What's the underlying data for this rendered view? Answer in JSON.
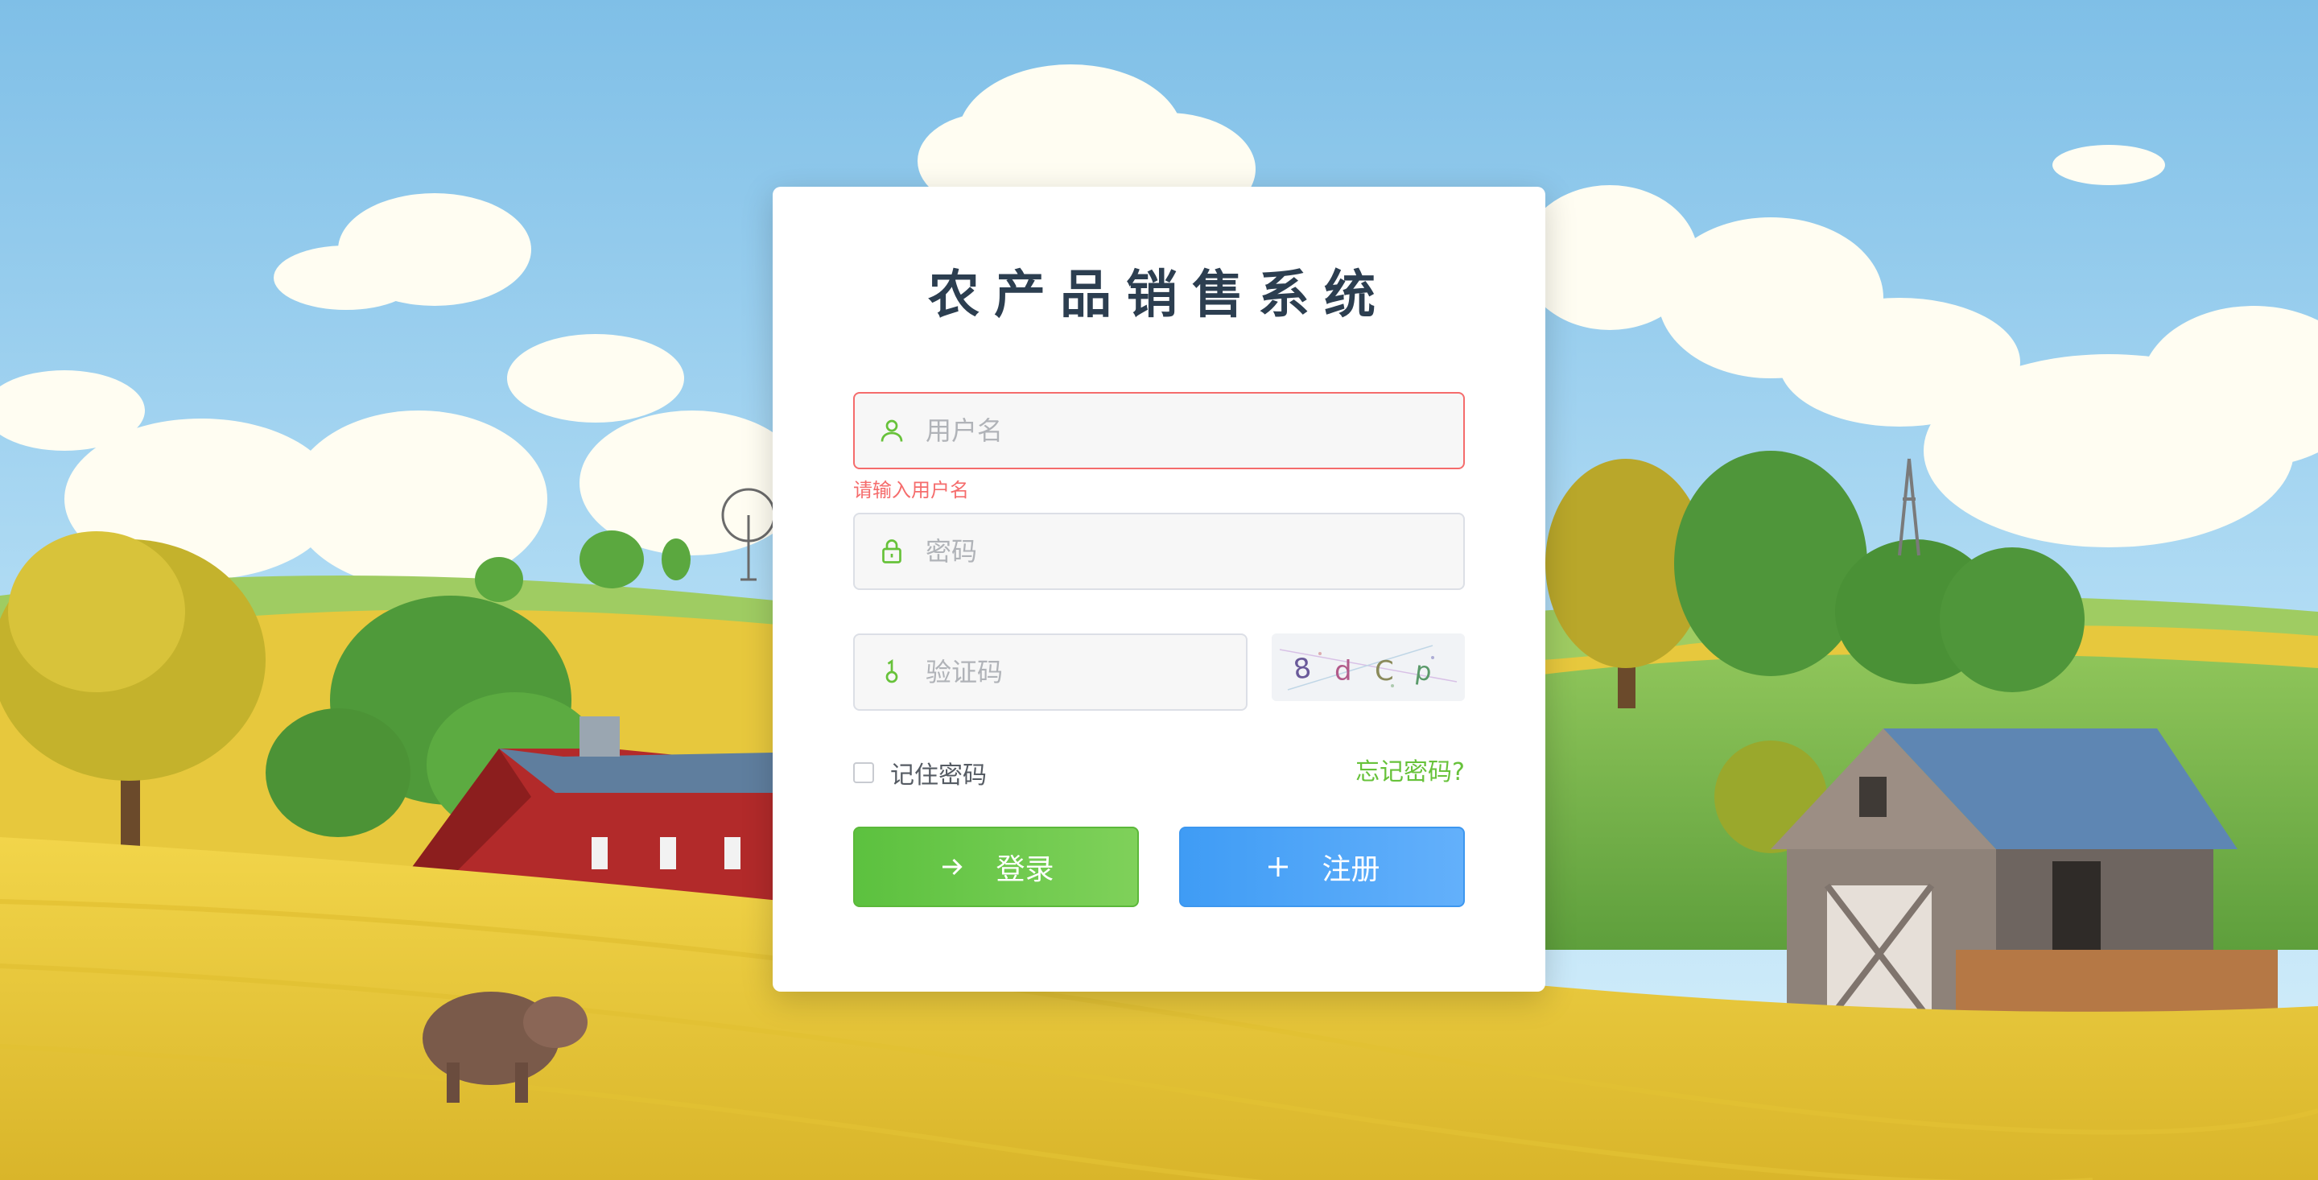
{
  "app": {
    "title": "农产品销售系统"
  },
  "form": {
    "username": {
      "placeholder": "用户名",
      "value": "",
      "error": "请输入用户名",
      "icon": "user-icon"
    },
    "password": {
      "placeholder": "密码",
      "value": "",
      "icon": "lock-icon"
    },
    "captcha": {
      "placeholder": "验证码",
      "value": "",
      "icon": "key-icon",
      "image_text": [
        "8",
        "d",
        "C",
        "p"
      ]
    },
    "remember_label": "记住密码",
    "remember_checked": false,
    "forgot_label": "忘记密码?"
  },
  "buttons": {
    "login_label": "登录",
    "login_icon": "arrow-right-icon",
    "register_label": "注册",
    "register_icon": "plus-icon"
  },
  "colors": {
    "title": "#2c3e50",
    "error": "#f56c6c",
    "accent_green": "#67c23a",
    "login_button": "#5cc13f",
    "register_button": "#409eff"
  }
}
